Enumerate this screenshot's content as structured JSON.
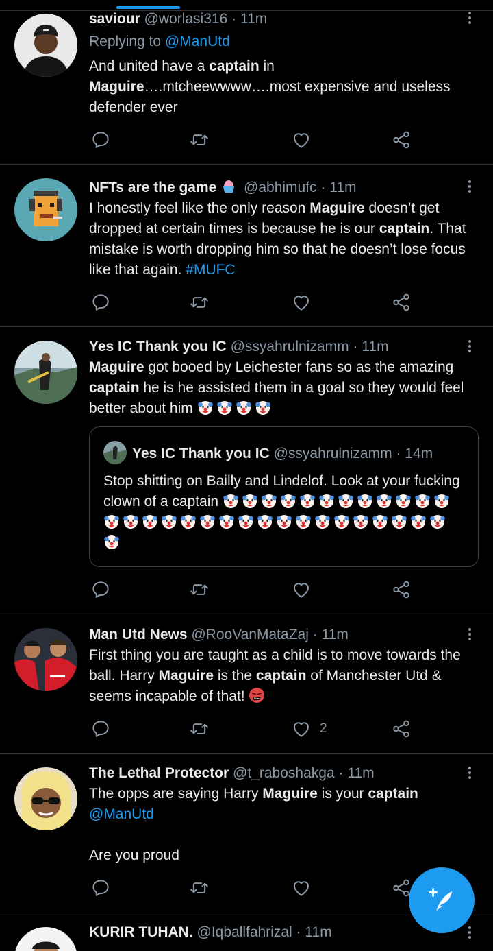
{
  "colors": {
    "accent": "#1d9bf0",
    "background": "#000000",
    "text": "#e7e9ea",
    "muted": "#8b98a5",
    "divider": "#2f3336"
  },
  "tweets": [
    {
      "display_name": "saviour",
      "handle": "@worlasi316",
      "time": "11m",
      "reply_prefix": "Replying to",
      "reply_to": "@ManUtd",
      "text_parts": [
        "And united have a ",
        "captain",
        " in ",
        "Maguire",
        "….mtcheewwww….most expensive and useless defender ever"
      ],
      "likes": ""
    },
    {
      "display_name": "NFTs are the game",
      "handle": "@abhimufc",
      "time": "11m",
      "name_emoji": "shaved-ice-emoji",
      "text_parts": [
        "I honestly feel like the only reason ",
        "Maguire",
        " doesn’t get dropped at certain times is because he is our ",
        "captain",
        ". That mistake is worth dropping him so that he doesn’t lose focus like that again. ",
        "#MUFC"
      ],
      "likes": ""
    },
    {
      "display_name": "Yes IC Thank you IC",
      "handle": "@ssyahrulnizamm",
      "time": "11m",
      "text_parts": [
        "Maguire",
        " got booed by Leichester fans so as the amazing ",
        "captain",
        " he is he assisted them in a goal so they would feel better about him"
      ],
      "emoji": "clown-face-emoji",
      "emoji_count": 4,
      "quote": {
        "display_name": "Yes IC Thank you IC",
        "handle": "@ssyahrulnizamm",
        "time": "14m",
        "text": "Stop shitting on Bailly and Lindelof. Look at your fucking clown of a captain",
        "emoji": "clown-face-emoji",
        "emoji_count": 31
      },
      "likes": ""
    },
    {
      "display_name": "Man Utd News",
      "handle": "@RooVanMataZaj",
      "time": "11m",
      "text_parts": [
        "First thing you are taught as a child is to move towards the ball. Harry ",
        "Maguire",
        " is the ",
        "captain",
        " of Manchester Utd & seems incapable of that!"
      ],
      "emoji": "face-with-symbols-on-mouth-emoji",
      "likes": "2"
    },
    {
      "display_name": "The Lethal Protector",
      "handle": "@t_raboshakga",
      "time": "11m",
      "text_parts": [
        "The opps are saying Harry ",
        "Maguire",
        " is your ",
        "captain"
      ],
      "mention": "@ManUtd",
      "text_after": "Are you proud",
      "likes": ""
    },
    {
      "display_name": "KURIR TUHAN.",
      "handle": "@Iqballfahrizal",
      "time": "11m"
    }
  ],
  "separator": "·",
  "icons": [
    "reply-icon",
    "retweet-icon",
    "like-icon",
    "share-icon",
    "more-icon",
    "compose-tweet-icon"
  ]
}
